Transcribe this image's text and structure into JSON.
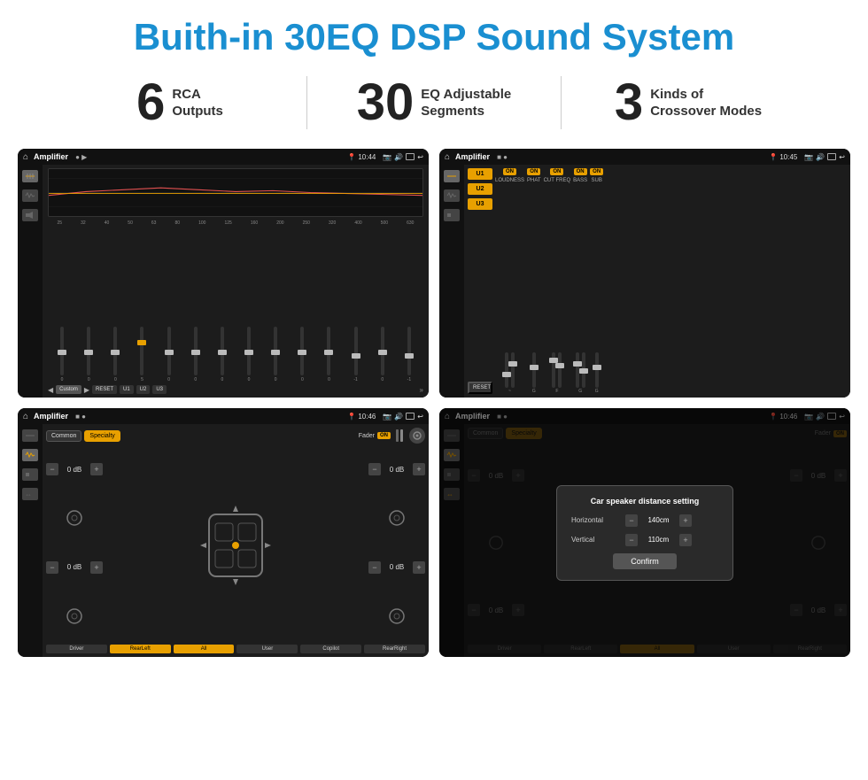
{
  "header": {
    "title": "Buith-in 30EQ DSP Sound System"
  },
  "stats": [
    {
      "number": "6",
      "label": "RCA\nOutputs"
    },
    {
      "number": "30",
      "label": "EQ Adjustable\nSegments"
    },
    {
      "number": "3",
      "label": "Kinds of\nCrossover Modes"
    }
  ],
  "screens": [
    {
      "id": "screen1",
      "title": "Amplifier",
      "time": "10:44",
      "type": "eq"
    },
    {
      "id": "screen2",
      "title": "Amplifier",
      "time": "10:45",
      "type": "crossover"
    },
    {
      "id": "screen3",
      "title": "Amplifier",
      "time": "10:46",
      "type": "fader"
    },
    {
      "id": "screen4",
      "title": "Amplifier",
      "time": "10:46",
      "type": "distance"
    }
  ],
  "eq": {
    "frequencies": [
      "25",
      "32",
      "40",
      "50",
      "63",
      "80",
      "100",
      "125",
      "160",
      "200",
      "250",
      "320",
      "400",
      "500",
      "630"
    ],
    "values": [
      "0",
      "0",
      "0",
      "5",
      "0",
      "0",
      "0",
      "0",
      "0",
      "0",
      "0",
      "-1",
      "0",
      "-1"
    ],
    "thumbPositions": [
      50,
      50,
      50,
      30,
      50,
      50,
      50,
      50,
      50,
      50,
      50,
      60,
      50,
      60
    ],
    "presets": [
      "Custom",
      "RESET",
      "U1",
      "U2",
      "U3"
    ]
  },
  "crossover": {
    "uButtons": [
      "U1",
      "U2",
      "U3"
    ],
    "cols": [
      {
        "label": "LOUDNESS",
        "on": true
      },
      {
        "label": "PHAT",
        "on": true
      },
      {
        "label": "CUT FREQ",
        "on": true
      },
      {
        "label": "BASS",
        "on": true
      },
      {
        "label": "SUB",
        "on": true
      }
    ]
  },
  "fader": {
    "tabs": [
      "Common",
      "Specialty"
    ],
    "activeTab": "Specialty",
    "faderLabel": "Fader",
    "dbValues": [
      "0 dB",
      "0 dB",
      "0 dB",
      "0 dB"
    ],
    "buttons": [
      "Driver",
      "RearLeft",
      "All",
      "Copilot",
      "RearRight",
      "User"
    ]
  },
  "distance": {
    "title": "Car speaker distance setting",
    "horizontal": "140cm",
    "vertical": "110cm",
    "confirmLabel": "Confirm"
  }
}
